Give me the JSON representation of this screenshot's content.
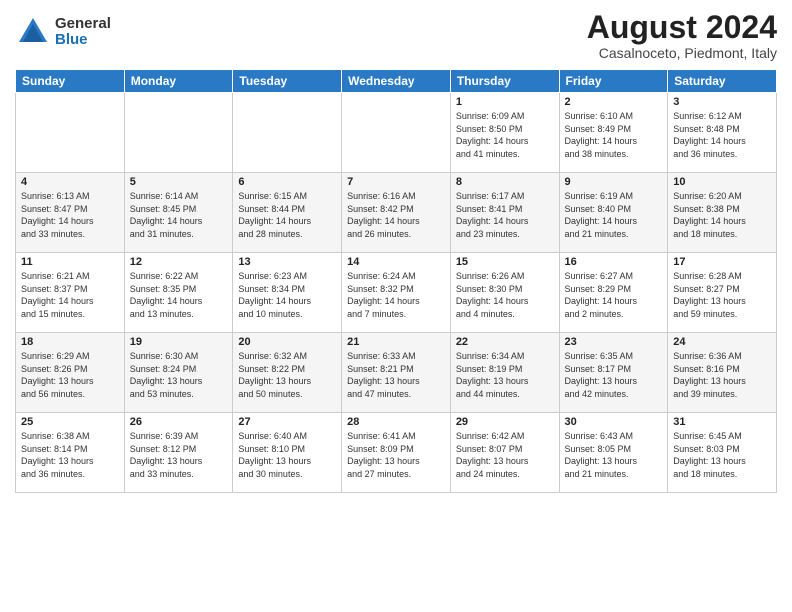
{
  "logo": {
    "general": "General",
    "blue": "Blue"
  },
  "title": "August 2024",
  "location": "Casalnoceto, Piedmont, Italy",
  "days_of_week": [
    "Sunday",
    "Monday",
    "Tuesday",
    "Wednesday",
    "Thursday",
    "Friday",
    "Saturday"
  ],
  "weeks": [
    [
      {
        "day": "",
        "info": ""
      },
      {
        "day": "",
        "info": ""
      },
      {
        "day": "",
        "info": ""
      },
      {
        "day": "",
        "info": ""
      },
      {
        "day": "1",
        "info": "Sunrise: 6:09 AM\nSunset: 8:50 PM\nDaylight: 14 hours\nand 41 minutes."
      },
      {
        "day": "2",
        "info": "Sunrise: 6:10 AM\nSunset: 8:49 PM\nDaylight: 14 hours\nand 38 minutes."
      },
      {
        "day": "3",
        "info": "Sunrise: 6:12 AM\nSunset: 8:48 PM\nDaylight: 14 hours\nand 36 minutes."
      }
    ],
    [
      {
        "day": "4",
        "info": "Sunrise: 6:13 AM\nSunset: 8:47 PM\nDaylight: 14 hours\nand 33 minutes."
      },
      {
        "day": "5",
        "info": "Sunrise: 6:14 AM\nSunset: 8:45 PM\nDaylight: 14 hours\nand 31 minutes."
      },
      {
        "day": "6",
        "info": "Sunrise: 6:15 AM\nSunset: 8:44 PM\nDaylight: 14 hours\nand 28 minutes."
      },
      {
        "day": "7",
        "info": "Sunrise: 6:16 AM\nSunset: 8:42 PM\nDaylight: 14 hours\nand 26 minutes."
      },
      {
        "day": "8",
        "info": "Sunrise: 6:17 AM\nSunset: 8:41 PM\nDaylight: 14 hours\nand 23 minutes."
      },
      {
        "day": "9",
        "info": "Sunrise: 6:19 AM\nSunset: 8:40 PM\nDaylight: 14 hours\nand 21 minutes."
      },
      {
        "day": "10",
        "info": "Sunrise: 6:20 AM\nSunset: 8:38 PM\nDaylight: 14 hours\nand 18 minutes."
      }
    ],
    [
      {
        "day": "11",
        "info": "Sunrise: 6:21 AM\nSunset: 8:37 PM\nDaylight: 14 hours\nand 15 minutes."
      },
      {
        "day": "12",
        "info": "Sunrise: 6:22 AM\nSunset: 8:35 PM\nDaylight: 14 hours\nand 13 minutes."
      },
      {
        "day": "13",
        "info": "Sunrise: 6:23 AM\nSunset: 8:34 PM\nDaylight: 14 hours\nand 10 minutes."
      },
      {
        "day": "14",
        "info": "Sunrise: 6:24 AM\nSunset: 8:32 PM\nDaylight: 14 hours\nand 7 minutes."
      },
      {
        "day": "15",
        "info": "Sunrise: 6:26 AM\nSunset: 8:30 PM\nDaylight: 14 hours\nand 4 minutes."
      },
      {
        "day": "16",
        "info": "Sunrise: 6:27 AM\nSunset: 8:29 PM\nDaylight: 14 hours\nand 2 minutes."
      },
      {
        "day": "17",
        "info": "Sunrise: 6:28 AM\nSunset: 8:27 PM\nDaylight: 13 hours\nand 59 minutes."
      }
    ],
    [
      {
        "day": "18",
        "info": "Sunrise: 6:29 AM\nSunset: 8:26 PM\nDaylight: 13 hours\nand 56 minutes."
      },
      {
        "day": "19",
        "info": "Sunrise: 6:30 AM\nSunset: 8:24 PM\nDaylight: 13 hours\nand 53 minutes."
      },
      {
        "day": "20",
        "info": "Sunrise: 6:32 AM\nSunset: 8:22 PM\nDaylight: 13 hours\nand 50 minutes."
      },
      {
        "day": "21",
        "info": "Sunrise: 6:33 AM\nSunset: 8:21 PM\nDaylight: 13 hours\nand 47 minutes."
      },
      {
        "day": "22",
        "info": "Sunrise: 6:34 AM\nSunset: 8:19 PM\nDaylight: 13 hours\nand 44 minutes."
      },
      {
        "day": "23",
        "info": "Sunrise: 6:35 AM\nSunset: 8:17 PM\nDaylight: 13 hours\nand 42 minutes."
      },
      {
        "day": "24",
        "info": "Sunrise: 6:36 AM\nSunset: 8:16 PM\nDaylight: 13 hours\nand 39 minutes."
      }
    ],
    [
      {
        "day": "25",
        "info": "Sunrise: 6:38 AM\nSunset: 8:14 PM\nDaylight: 13 hours\nand 36 minutes."
      },
      {
        "day": "26",
        "info": "Sunrise: 6:39 AM\nSunset: 8:12 PM\nDaylight: 13 hours\nand 33 minutes."
      },
      {
        "day": "27",
        "info": "Sunrise: 6:40 AM\nSunset: 8:10 PM\nDaylight: 13 hours\nand 30 minutes."
      },
      {
        "day": "28",
        "info": "Sunrise: 6:41 AM\nSunset: 8:09 PM\nDaylight: 13 hours\nand 27 minutes."
      },
      {
        "day": "29",
        "info": "Sunrise: 6:42 AM\nSunset: 8:07 PM\nDaylight: 13 hours\nand 24 minutes."
      },
      {
        "day": "30",
        "info": "Sunrise: 6:43 AM\nSunset: 8:05 PM\nDaylight: 13 hours\nand 21 minutes."
      },
      {
        "day": "31",
        "info": "Sunrise: 6:45 AM\nSunset: 8:03 PM\nDaylight: 13 hours\nand 18 minutes."
      }
    ]
  ]
}
